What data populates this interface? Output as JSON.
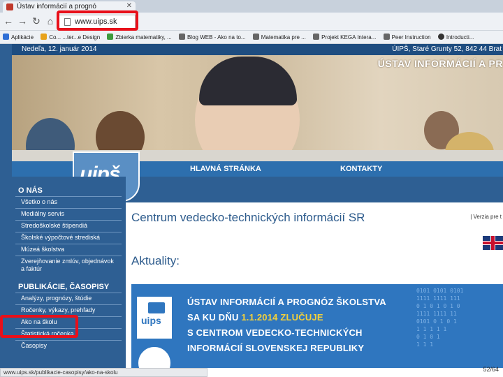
{
  "browser": {
    "tab_title": "Ústav informácií a prognó",
    "url": "www.uips.sk",
    "bookmarks": [
      {
        "label": "Aplikácie",
        "color": "#2f6fd6"
      },
      {
        "label": "Co... ...ter...e Design",
        "color": "#e8a21a"
      },
      {
        "label": "Zbierka matematiky, ...",
        "color": "#3c9a3c"
      },
      {
        "label": "Blog WEB - Ako na to...",
        "color": "#666666"
      },
      {
        "label": "Matematika pre ...",
        "color": "#666666"
      },
      {
        "label": "Projekt KEGA Intera...",
        "color": "#666666"
      },
      {
        "label": "Peer Instruction",
        "color": "#666666"
      },
      {
        "label": "Introducti...",
        "color": "#333333"
      }
    ],
    "status_url": "www.uips.sk/publikacie-casopisy/ako-na-skolu"
  },
  "site": {
    "date": "Nedeľa, 12. január 2014",
    "address": "ÚIPŠ, Staré Grunty 52, 842 44 Brat",
    "hero_title": "ÚSTAV INFORMÁCIÍ A PR",
    "logo_text": "uipš",
    "nav": {
      "home": "HLAVNÁ STRÁNKA",
      "contacts": "KONTAKTY"
    },
    "sidebar": {
      "section1": "O NÁS",
      "items1": [
        "Všetko o nás",
        "Mediálny servis",
        "Stredoškolské štipendiá",
        "Školské výpočtové strediská",
        "Múzeá školstva",
        "Zverejňovanie zmlúv, objednávok",
        "a faktúr"
      ],
      "section2": "PUBLIKÁCIE, ČASOPISY",
      "items2": [
        "Analýzy, prognózy, štúdie",
        "Ročenky, výkazy, prehľady",
        "Ako na školu",
        "Štatistická ročenka",
        "Časopisy"
      ]
    },
    "content": {
      "title": "Centrum vedecko-technických informácií SR",
      "version_link": "| Verzia pre t",
      "news_heading": "Aktuality:",
      "banner": {
        "logo": "uips",
        "line1": "ÚSTAV INFORMÁCIÍ A PROGNÓZ ŠKOLSTVA",
        "line2_pre": "SA KU DŇU ",
        "line2_hl": "1.1.2014 ZLUČUJE",
        "line3": "S CENTROM VEDECKO-TECHNICKÝCH",
        "line4": "INFORMÁCIÍ SLOVENSKEJ REPUBLIKY",
        "binary": "0101 0101 0101\n1111 1111 111\n0 1 0 1 0 1 0\n1111 1111 11\n0101 0 1 0 1\n1 1 1 1 1\n0 1 0 1\n1 1 1"
      }
    }
  },
  "slide_counter": "52/64",
  "colors": {
    "highlight": "#e8101a",
    "site_blue": "#2e5f93",
    "banner_blue": "#2f76bf",
    "accent_yellow": "#f4d13a"
  }
}
